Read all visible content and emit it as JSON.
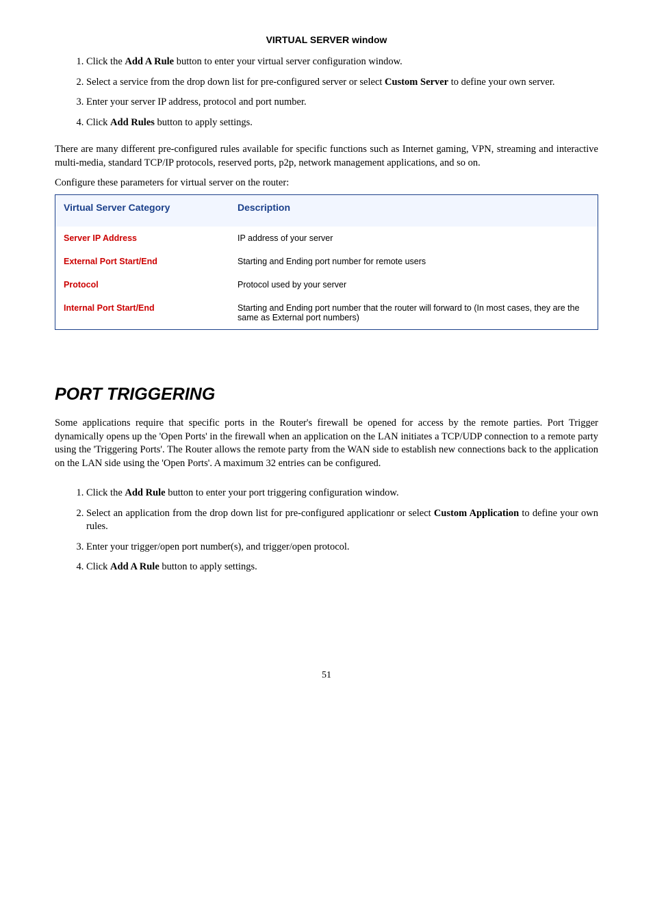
{
  "heading1": "VIRTUAL SERVER window",
  "steps1": [
    {
      "pre": "Click the ",
      "b": "Add A Rule",
      "post": " button to enter your virtual server configuration window."
    },
    {
      "pre": "Select a service from the drop down list for pre-configured server or select ",
      "b": "Custom Server",
      "post": " to define your own server."
    },
    {
      "pre": "Enter your server IP address, protocol and port number.",
      "b": "",
      "post": ""
    },
    {
      "pre": "Click ",
      "b": "Add Rules",
      "post": " button to apply settings."
    }
  ],
  "para1": "There are many different pre-configured rules available for specific functions such as Internet gaming, VPN, streaming and interactive multi-media, standard TCP/IP protocols, reserved ports, p2p, network management applications, and so on.",
  "para2": "Configure these parameters for virtual server on the router:",
  "table": {
    "head1": "Virtual Server Category",
    "head2": "Description",
    "rows": [
      {
        "k": "Server IP Address",
        "v": "IP address of your server"
      },
      {
        "k": "External Port Start/End",
        "v": "Starting and Ending port number for remote users"
      },
      {
        "k": "Protocol",
        "v": "Protocol used by your server"
      },
      {
        "k": "Internal Port Start/End",
        "v": "Starting and Ending port number that the router will forward to (In most cases, they are the same as External port numbers)"
      }
    ]
  },
  "sectionTitle": "PORT TRIGGERING",
  "para3": "Some applications require that specific ports in the Router's firewall be opened for access by the remote parties. Port Trigger dynamically opens up the 'Open Ports' in the firewall when an application on the LAN initiates a TCP/UDP connection to a remote party using the 'Triggering Ports'. The Router allows the remote party from the WAN side to establish new connections back to the application on the LAN side using the 'Open Ports'. A maximum 32 entries can be configured.",
  "steps2": [
    {
      "pre": "Click the ",
      "b": "Add Rule",
      "post": " button to enter your port triggering configuration window."
    },
    {
      "pre": "Select an application from the drop down list for pre-configured applicationr or select ",
      "b": "Custom Application",
      "post": " to define your own rules."
    },
    {
      "pre": "Enter your trigger/open port number(s), and trigger/open protocol.",
      "b": "",
      "post": ""
    },
    {
      "pre": "Click ",
      "b": "Add A Rule",
      "post": " button to apply settings."
    }
  ],
  "pageNumber": "51"
}
